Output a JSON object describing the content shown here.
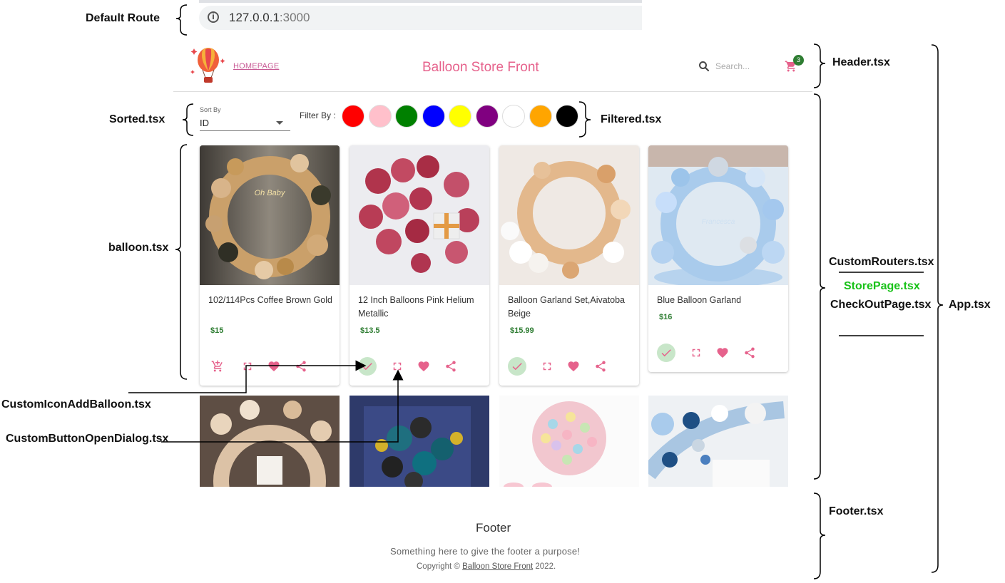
{
  "annotations": {
    "default_route": "Default Route",
    "sorted": "Sorted.tsx",
    "balloon": "balloon.tsx",
    "custom_icon_add": "CustomIconAddBalloon.tsx",
    "custom_button_dialog": "CustomButtonOpenDialog.tsx",
    "header": "Header.tsx",
    "filtered": "Filtered.tsx",
    "custom_routers": "CustomRouters.tsx",
    "store_page": "StorePage.tsx",
    "checkout_page": "CheckOutPage.tsx",
    "app": "App.tsx",
    "footer": "Footer.tsx"
  },
  "address_bar": {
    "host": "127.0.0.1",
    "port": ":3000"
  },
  "header": {
    "homepage_link": "HOMEPAGE",
    "title": "Balloon Store Front",
    "search_placeholder": "Search...",
    "cart_count": "3"
  },
  "sort": {
    "label": "Sort By",
    "value": "ID"
  },
  "filter": {
    "label": "Filter By :",
    "colors": [
      "#ff0000",
      "#ffc0cb",
      "#008000",
      "#0000ff",
      "#ffff00",
      "#800080",
      "#ffffff",
      "#ffa500",
      "#000000"
    ]
  },
  "products": [
    {
      "name": "102/114Pcs Coffee Brown Gold",
      "price": "$15",
      "in_cart": false
    },
    {
      "name": "12 Inch Balloons Pink Helium Metallic",
      "price": "$13.5",
      "in_cart": true
    },
    {
      "name": "Balloon Garland Set,Aivatoba Beige",
      "price": "$15.99",
      "in_cart": true
    },
    {
      "name": "Blue Balloon Garland",
      "price": "$16",
      "in_cart": true
    }
  ],
  "footer": {
    "title": "Footer",
    "subtitle": "Something here to give the footer a purpose!",
    "copyright_prefix": "Copyright © ",
    "copyright_link": "Balloon Store Front",
    "copyright_suffix": " 2022."
  },
  "colors": {
    "accent": "#e6628c",
    "price": "#2e7d32",
    "badge": "#2e7d32",
    "checked_bg": "#c8e6c9"
  },
  "icons": [
    "info-icon",
    "search-icon",
    "cart-icon",
    "add-cart-icon",
    "check-icon",
    "fullscreen-icon",
    "heart-icon",
    "share-icon"
  ]
}
